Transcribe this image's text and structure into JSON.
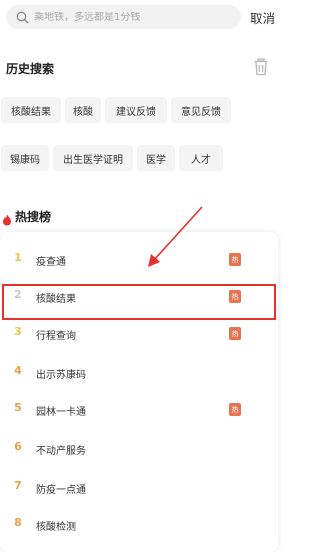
{
  "search": {
    "placeholder": "乘地铁，多远都是1分钱"
  },
  "cancel_label": "取消",
  "history": {
    "title": "历史搜索",
    "chips": [
      "核酸结果",
      "核酸",
      "建议反馈",
      "意见反馈",
      "锡康码",
      "出生医学证明",
      "医学",
      "人才"
    ]
  },
  "hot": {
    "title": "热搜榜",
    "badge_label": "热",
    "items": [
      {
        "rank": "1",
        "label": "疫查通",
        "hot": true
      },
      {
        "rank": "2",
        "label": "核酸结果",
        "hot": true
      },
      {
        "rank": "3",
        "label": "行程查询",
        "hot": true
      },
      {
        "rank": "4",
        "label": "出示苏康码",
        "hot": false
      },
      {
        "rank": "5",
        "label": "园林一卡通",
        "hot": true
      },
      {
        "rank": "6",
        "label": "不动产服务",
        "hot": false
      },
      {
        "rank": "7",
        "label": "防疫一点通",
        "hot": false
      },
      {
        "rank": "8",
        "label": "核酸检测",
        "hot": false
      }
    ]
  },
  "colors": {
    "accent_red": "#e5322d",
    "hot_badge": "#e9744f",
    "rank_top": "#f5c24c",
    "rank_other": "#e9a14b"
  }
}
